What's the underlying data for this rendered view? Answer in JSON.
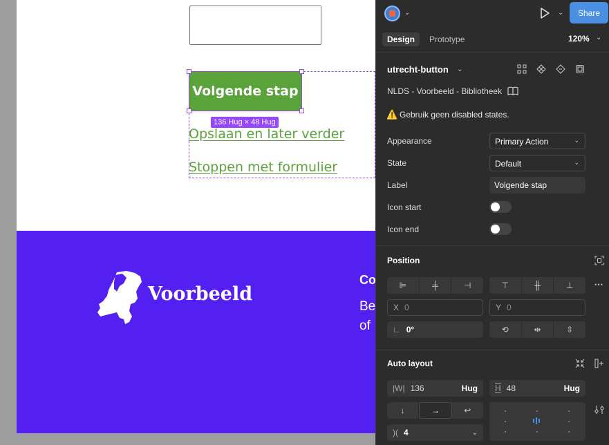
{
  "canvas": {
    "primary_button_label": "Volgende stap",
    "size_badge": "136 Hug × 48 Hug",
    "link1": "Opslaan en later verder",
    "link2": "Stoppen met formulier",
    "brand_name": "Voorbeeld",
    "footer_heading": "Co",
    "footer_line1": "Be",
    "footer_line2": "of"
  },
  "topbar": {
    "share_label": "Share",
    "tabs": [
      {
        "label": "Design",
        "active": true
      },
      {
        "label": "Prototype",
        "active": false
      }
    ],
    "zoom": "120%"
  },
  "component": {
    "name": "utrecht-button",
    "library": "NLDS - Voorbeeld - Bibliotheek",
    "warning": "Gebruik geen disabled states."
  },
  "properties": {
    "appearance": {
      "label": "Appearance",
      "value": "Primary Action"
    },
    "state": {
      "label": "State",
      "value": "Default"
    },
    "label": {
      "label": "Label",
      "value": "Volgende stap"
    },
    "icon_start": {
      "label": "Icon start",
      "on": false
    },
    "icon_end": {
      "label": "Icon end",
      "on": false
    }
  },
  "position": {
    "title": "Position",
    "x_label": "X",
    "x_value": "0",
    "y_label": "Y",
    "y_value": "0",
    "rotation": "0°"
  },
  "auto_layout": {
    "title": "Auto layout",
    "w_label": "W",
    "w_value": "136",
    "w_mode": "Hug",
    "h_label": "H",
    "h_value": "48",
    "h_mode": "Hug",
    "gap": "4"
  },
  "colors": {
    "panel_bg": "#2c2c2c",
    "accent": "#4a90e2",
    "selection": "#9747ff",
    "button_green": "#5aa33a",
    "footer_purple": "#5420f2"
  }
}
